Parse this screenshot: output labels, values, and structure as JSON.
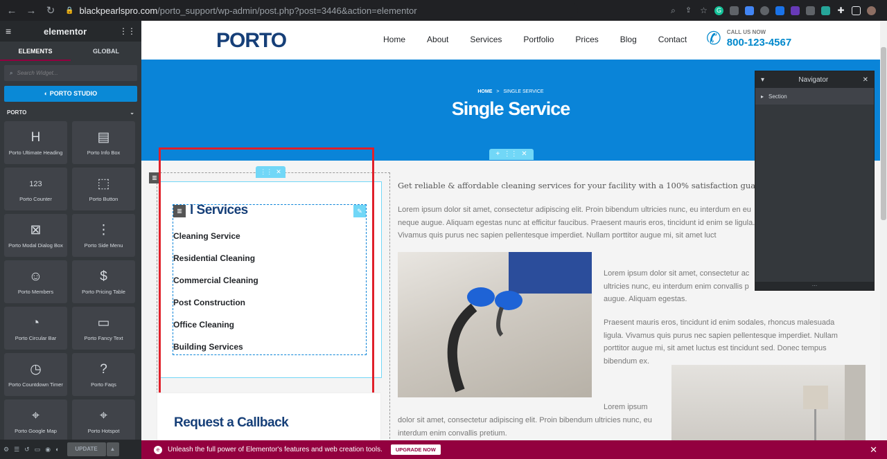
{
  "browser": {
    "url_host": "blackpearlspro.com",
    "url_path": "/porto_support/wp-admin/post.php?post=3446&action=elementor"
  },
  "panel": {
    "brand": "elementor",
    "tabs": [
      "ELEMENTS",
      "GLOBAL"
    ],
    "search_placeholder": "Search Widget...",
    "studio_label": "PORTO STUDIO",
    "category": "PORTO",
    "widgets": [
      {
        "label": "Porto Ultimate Heading",
        "icon": "H"
      },
      {
        "label": "Porto Info Box",
        "icon": "▤"
      },
      {
        "label": "Porto Counter",
        "icon": "123"
      },
      {
        "label": "Porto Button",
        "icon": "⬚"
      },
      {
        "label": "Porto Modal Dialog Box",
        "icon": "⊠"
      },
      {
        "label": "Porto Side Menu",
        "icon": "⋮"
      },
      {
        "label": "Porto Members",
        "icon": "☺"
      },
      {
        "label": "Porto Pricing Table",
        "icon": "$"
      },
      {
        "label": "Porto Circular Bar",
        "icon": "◔"
      },
      {
        "label": "Porto Fancy Text",
        "icon": "▭"
      },
      {
        "label": "Porto Countdown Timer",
        "icon": "◷"
      },
      {
        "label": "Porto Faqs",
        "icon": "?"
      },
      {
        "label": "Porto Google Map",
        "icon": "⌖"
      },
      {
        "label": "Porto Hotspot",
        "icon": "⌖"
      }
    ],
    "update_label": "UPDATE"
  },
  "site": {
    "logo": "PORTO",
    "menu": [
      "Home",
      "About",
      "Services",
      "Portfolio",
      "Prices",
      "Blog",
      "Contact"
    ],
    "call_label": "CALL US NOW",
    "phone": "800-123-4567",
    "breadcrumb_home": "HOME",
    "breadcrumb_sep": ">",
    "breadcrumb_current": "SINGLE SERVICE",
    "page_title": "Single Service",
    "services_title": "l Services",
    "services": [
      "Cleaning Service",
      "Residential Cleaning",
      "Commercial Cleaning",
      "Post Construction",
      "Office Cleaning",
      "Building Services"
    ],
    "callback_title": "Request a Callback",
    "lead": "Get reliable & affordable cleaning services for your facility with a 100% satisfaction guarant",
    "p1": "Lorem ipsum dolor sit amet, consectetur adipiscing elit. Proin bibendum ultricies nunc, eu interdum en eu neque augue. Aliquam egestas nunc at efficitur faucibus. Praesent mauris eros, tincidunt id enim se ligula. Vivamus quis purus nec sapien pellentesque imperdiet. Nullam porttitor augue mi, sit amet luct",
    "p2": "Lorem ipsum dolor sit amet, consectetur ac ultricies nunc, eu interdum enim convallis p augue. Aliquam egestas.",
    "p3": "Praesent mauris eros, tincidunt id enim sodales, rhoncus malesuada ligula. Vivamus quis purus nec sapien pellentesque imperdiet. Nullam porttitor augue mi, sit amet luctus est tincidunt sed. Donec tempus bibendum ex.",
    "p4a": "Lorem ipsum",
    "p4": "dolor sit amet, consectetur adipiscing elit. Proin bibendum ultricies nunc, eu interdum enim convallis pretium."
  },
  "navigator": {
    "title": "Navigator",
    "row": "Section"
  },
  "promo": {
    "text": "Unleash the full power of Elementor's features and web creation tools.",
    "button": "UPGRADE NOW"
  }
}
